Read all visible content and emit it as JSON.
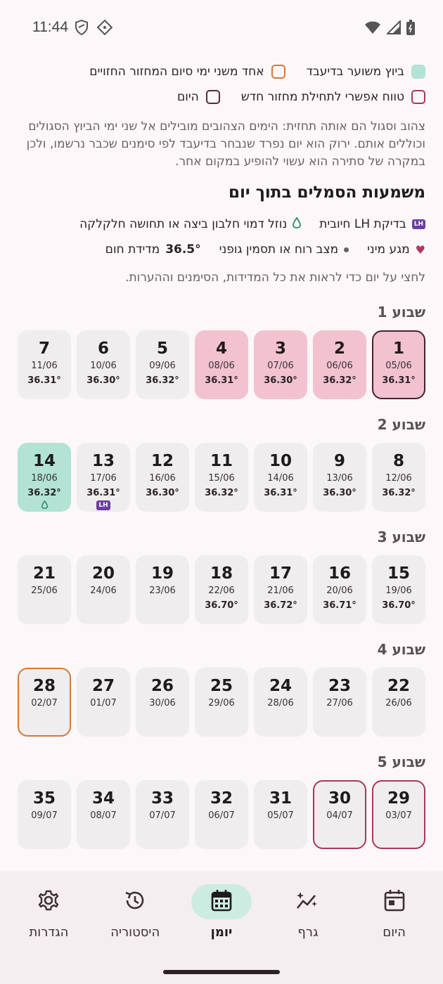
{
  "status": {
    "time": "11:44"
  },
  "legend": {
    "row1": [
      {
        "label": "ביוץ משוער בדיעבד",
        "style": "green"
      },
      {
        "label": "אחד משני ימי סיום המחזור החזויים",
        "style": "orange"
      }
    ],
    "row2": [
      {
        "label": "טווח אפשרי לתחילת מחזור חדש",
        "style": "pink"
      },
      {
        "label": "היום",
        "style": "dark"
      }
    ]
  },
  "explanation": "צהוב וסגול הם אותה תחזית: הימים הצהובים מובילים אל שני ימי הביוץ הסגולים וכוללים אותם. ירוק הוא יום נפרד שנבחר בדיעבד לפי סימנים שכבר נרשמו, ולכן במקרה של סתירה הוא עשוי להופיע במקום אחר.",
  "symbols": {
    "title": "משמעות הסמלים בתוך יום",
    "lh_badge": "LH",
    "lh_label": "בדיקת LH חיובית",
    "drop_label": "נוזל דמוי חלבון ביצה או תחושה חלקלקה",
    "heart_label": "מגע מיני",
    "dot_label": "מצב רוח או תסמין גופני",
    "temp_value": "36.5°",
    "temp_label": "מדידת חום",
    "hint": "לחצי על יום כדי לראות את כל המדידות, הסימנים וההערות."
  },
  "weeks": [
    {
      "title": "שבוע 1",
      "days": [
        {
          "num": "1",
          "date": "05/06",
          "temp": "36.31°",
          "style": "pink outline-dark"
        },
        {
          "num": "2",
          "date": "06/06",
          "temp": "36.32°",
          "style": "pink"
        },
        {
          "num": "3",
          "date": "07/06",
          "temp": "36.30°",
          "style": "pink"
        },
        {
          "num": "4",
          "date": "08/06",
          "temp": "36.31°",
          "style": "pink"
        },
        {
          "num": "5",
          "date": "09/06",
          "temp": "36.32°",
          "style": ""
        },
        {
          "num": "6",
          "date": "10/06",
          "temp": "36.30°",
          "style": ""
        },
        {
          "num": "7",
          "date": "11/06",
          "temp": "36.31°",
          "style": ""
        }
      ]
    },
    {
      "title": "שבוע 2",
      "days": [
        {
          "num": "8",
          "date": "12/06",
          "temp": "36.32°",
          "style": ""
        },
        {
          "num": "9",
          "date": "13/06",
          "temp": "36.30°",
          "style": ""
        },
        {
          "num": "10",
          "date": "14/06",
          "temp": "36.31°",
          "style": ""
        },
        {
          "num": "11",
          "date": "15/06",
          "temp": "36.32°",
          "style": ""
        },
        {
          "num": "12",
          "date": "16/06",
          "temp": "36.30°",
          "style": ""
        },
        {
          "num": "13",
          "date": "17/06",
          "temp": "36.31°",
          "style": "",
          "mark": "LH"
        },
        {
          "num": "14",
          "date": "18/06",
          "temp": "36.32°",
          "style": "green",
          "mark": "drop"
        }
      ]
    },
    {
      "title": "שבוע 3",
      "days": [
        {
          "num": "15",
          "date": "19/06",
          "temp": "36.70°",
          "style": ""
        },
        {
          "num": "16",
          "date": "20/06",
          "temp": "36.71°",
          "style": ""
        },
        {
          "num": "17",
          "date": "21/06",
          "temp": "36.72°",
          "style": ""
        },
        {
          "num": "18",
          "date": "22/06",
          "temp": "36.70°",
          "style": ""
        },
        {
          "num": "19",
          "date": "23/06",
          "temp": "",
          "style": ""
        },
        {
          "num": "20",
          "date": "24/06",
          "temp": "",
          "style": ""
        },
        {
          "num": "21",
          "date": "25/06",
          "temp": "",
          "style": ""
        }
      ]
    },
    {
      "title": "שבוע 4",
      "days": [
        {
          "num": "22",
          "date": "26/06",
          "temp": "",
          "style": ""
        },
        {
          "num": "23",
          "date": "27/06",
          "temp": "",
          "style": ""
        },
        {
          "num": "24",
          "date": "28/06",
          "temp": "",
          "style": ""
        },
        {
          "num": "25",
          "date": "29/06",
          "temp": "",
          "style": ""
        },
        {
          "num": "26",
          "date": "30/06",
          "temp": "",
          "style": ""
        },
        {
          "num": "27",
          "date": "01/07",
          "temp": "",
          "style": ""
        },
        {
          "num": "28",
          "date": "02/07",
          "temp": "",
          "style": "outline-orange"
        }
      ]
    },
    {
      "title": "שבוע 5",
      "days": [
        {
          "num": "29",
          "date": "03/07",
          "temp": "",
          "style": "outline-pink"
        },
        {
          "num": "30",
          "date": "04/07",
          "temp": "",
          "style": "outline-pink"
        },
        {
          "num": "31",
          "date": "05/07",
          "temp": "",
          "style": ""
        },
        {
          "num": "32",
          "date": "06/07",
          "temp": "",
          "style": ""
        },
        {
          "num": "33",
          "date": "07/07",
          "temp": "",
          "style": ""
        },
        {
          "num": "34",
          "date": "08/07",
          "temp": "",
          "style": ""
        },
        {
          "num": "35",
          "date": "09/07",
          "temp": "",
          "style": ""
        }
      ]
    }
  ],
  "nav": [
    {
      "label": "היום",
      "icon": "calendar-today-icon",
      "active": false
    },
    {
      "label": "גרף",
      "icon": "sparkle-chart-icon",
      "active": false
    },
    {
      "label": "יומן",
      "icon": "calendar-month-icon",
      "active": true
    },
    {
      "label": "היסטוריה",
      "icon": "history-icon",
      "active": false
    },
    {
      "label": "הגדרות",
      "icon": "gear-icon",
      "active": false
    }
  ],
  "colors": {
    "accent_green": "#b2e3d4",
    "pink": "#f2c2d1",
    "orange_outline": "#d27a3a",
    "pink_outline": "#a8385a",
    "lh_purple": "#6b3fa0"
  }
}
